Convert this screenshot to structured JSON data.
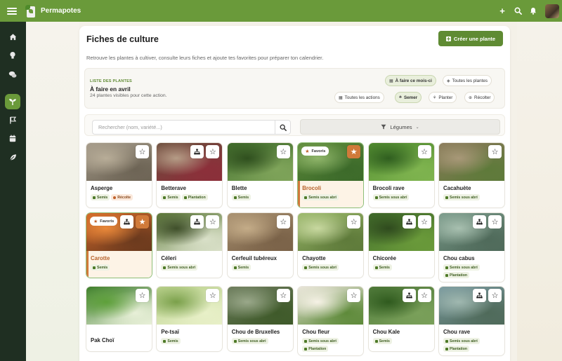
{
  "app": {
    "brand": "Permapotes",
    "brand_color": "#6a9a3a"
  },
  "topbar": {
    "menu_icon": "hamburger-icon",
    "actions": [
      {
        "name": "add",
        "icon": "plus-icon"
      },
      {
        "name": "search",
        "icon": "search-icon"
      },
      {
        "name": "notifications",
        "icon": "bell-icon"
      },
      {
        "name": "avatar",
        "icon": "avatar"
      }
    ]
  },
  "sidebar": {
    "items": [
      {
        "name": "home",
        "icon": "home-icon",
        "active": false
      },
      {
        "name": "ideas",
        "icon": "lightbulb-icon",
        "active": false
      },
      {
        "name": "messages",
        "icon": "chat-icon",
        "active": false
      },
      {
        "name": "plants",
        "icon": "sprout-icon",
        "active": true
      },
      {
        "name": "tasks",
        "icon": "flag-icon",
        "active": false
      },
      {
        "name": "calendar",
        "icon": "calendar-icon",
        "active": false
      },
      {
        "name": "garden",
        "icon": "leaf-icon",
        "active": false
      }
    ]
  },
  "page": {
    "title": "Fiches de culture",
    "create_label": "Créer une plante",
    "subtitle": "Retrouve les plantes à cultiver, consulte leurs fiches et ajoute tes favorites pour préparer ton calendrier."
  },
  "filters": {
    "caption": "LISTE DES PLANTES",
    "title": "À faire en avril",
    "count": "24 plantes visibles pour cette action.",
    "scope": [
      {
        "label": "À faire ce mois-ci",
        "icon": "calendar-icon",
        "selected": true
      },
      {
        "label": "Toutes les plantes",
        "icon": "layers-icon",
        "selected": false
      }
    ],
    "actions": [
      {
        "label": "Toutes les actions",
        "icon": "calendar-icon",
        "selected": false
      },
      {
        "label": "Semer",
        "icon": "seedling-icon",
        "selected": true
      },
      {
        "label": "Planter",
        "icon": "plant-icon",
        "selected": false
      },
      {
        "label": "Récolter",
        "icon": "basket-icon",
        "selected": false
      }
    ]
  },
  "search": {
    "placeholder": "Rechercher (nom, variété...)",
    "value": ""
  },
  "category": {
    "label": "Légumes"
  },
  "favorite_label": "Favoris",
  "plants": [
    {
      "name": "Asperge",
      "favorite": false,
      "assoc": false,
      "tags": [
        {
          "label": "Semis",
          "type": "green"
        },
        {
          "label": "Récolte",
          "type": "orange"
        }
      ],
      "colors": [
        "#a59b8a",
        "#6d6455",
        "#b8ad98"
      ]
    },
    {
      "name": "Betterave",
      "favorite": false,
      "assoc": true,
      "tags": [
        {
          "label": "Semis",
          "type": "green"
        },
        {
          "label": "Plantation",
          "type": "green"
        }
      ],
      "colors": [
        "#6b4d3c",
        "#8c2f3a",
        "#b59c86"
      ]
    },
    {
      "name": "Blette",
      "favorite": false,
      "assoc": false,
      "tags": [
        {
          "label": "Semis",
          "type": "green"
        }
      ],
      "colors": [
        "#3f6b2a",
        "#7fa45a",
        "#2f4f1e"
      ]
    },
    {
      "name": "Brocoli",
      "favorite": true,
      "assoc": false,
      "tags": [
        {
          "label": "Semis sous abri",
          "type": "green"
        }
      ],
      "colors": [
        "#5e8a3a",
        "#3c6a2a",
        "#8fb56a"
      ]
    },
    {
      "name": "Brocoli rave",
      "favorite": false,
      "assoc": false,
      "tags": [
        {
          "label": "Semis sous abri",
          "type": "green"
        }
      ],
      "colors": [
        "#4f8a2e",
        "#7fb44f",
        "#2f5e1f"
      ]
    },
    {
      "name": "Cacahuète",
      "favorite": false,
      "assoc": false,
      "tags": [
        {
          "label": "Semis sous abri",
          "type": "green"
        }
      ],
      "colors": [
        "#8a7a5a",
        "#5e7a3a",
        "#a89878"
      ]
    },
    {
      "name": "Carotte",
      "favorite": true,
      "assoc": true,
      "tags": [
        {
          "label": "Semis",
          "type": "green"
        }
      ],
      "colors": [
        "#d2692a",
        "#6b3a1e",
        "#e8883a"
      ]
    },
    {
      "name": "Céleri",
      "favorite": false,
      "assoc": true,
      "tags": [
        {
          "label": "Semis sous abri",
          "type": "green"
        }
      ],
      "colors": [
        "#5e7a3a",
        "#d9e0c8",
        "#3f4f2a"
      ]
    },
    {
      "name": "Cerfeuil tubéreux",
      "favorite": false,
      "assoc": false,
      "tags": [
        {
          "label": "Semis",
          "type": "green"
        }
      ],
      "colors": [
        "#a89070",
        "#7a6248",
        "#c4ac88"
      ]
    },
    {
      "name": "Chayotte",
      "favorite": false,
      "assoc": false,
      "tags": [
        {
          "label": "Semis sous abri",
          "type": "green"
        }
      ],
      "colors": [
        "#9ab86a",
        "#5e7a3a",
        "#c8d8a0"
      ]
    },
    {
      "name": "Chicorée",
      "favorite": false,
      "assoc": true,
      "tags": [
        {
          "label": "Semis",
          "type": "green"
        }
      ],
      "colors": [
        "#3f6a2a",
        "#6a9a3a",
        "#2f4a1e"
      ]
    },
    {
      "name": "Chou cabus",
      "favorite": false,
      "assoc": true,
      "tags": [
        {
          "label": "Semis sous abri",
          "type": "green"
        },
        {
          "label": "Plantation",
          "type": "green"
        }
      ],
      "colors": [
        "#7a9a8a",
        "#4f6a5a",
        "#a8c0b0"
      ]
    },
    {
      "name": "Pak Choï",
      "favorite": false,
      "assoc": false,
      "tags": [],
      "colors": [
        "#3a7a2a",
        "#e8f0d8",
        "#5ea03a"
      ]
    },
    {
      "name": "Pe-tsaï",
      "favorite": false,
      "assoc": false,
      "tags": [
        {
          "label": "Semis",
          "type": "green"
        }
      ],
      "colors": [
        "#b8d08a",
        "#e8f0c8",
        "#7aa04a"
      ]
    },
    {
      "name": "Chou de Bruxelles",
      "favorite": false,
      "assoc": false,
      "tags": [
        {
          "label": "Semis sous abri",
          "type": "green"
        }
      ],
      "colors": [
        "#6a7a5a",
        "#3f5a2a",
        "#9aa88a"
      ]
    },
    {
      "name": "Chou fleur",
      "favorite": false,
      "assoc": false,
      "tags": [
        {
          "label": "Semis sous abri",
          "type": "green"
        },
        {
          "label": "Plantation",
          "type": "green"
        }
      ],
      "colors": [
        "#e8e4d8",
        "#5e8a3a",
        "#f6f2e6"
      ]
    },
    {
      "name": "Chou Kale",
      "favorite": false,
      "assoc": true,
      "tags": [
        {
          "label": "Semis",
          "type": "green"
        }
      ],
      "colors": [
        "#4f7a3a",
        "#7aa05a",
        "#2f5a1e"
      ]
    },
    {
      "name": "Chou rave",
      "favorite": false,
      "assoc": true,
      "tags": [
        {
          "label": "Semis sous abri",
          "type": "green"
        },
        {
          "label": "Plantation",
          "type": "green"
        }
      ],
      "colors": [
        "#7a9aa0",
        "#4f6a5a",
        "#a0b8b0"
      ]
    }
  ]
}
